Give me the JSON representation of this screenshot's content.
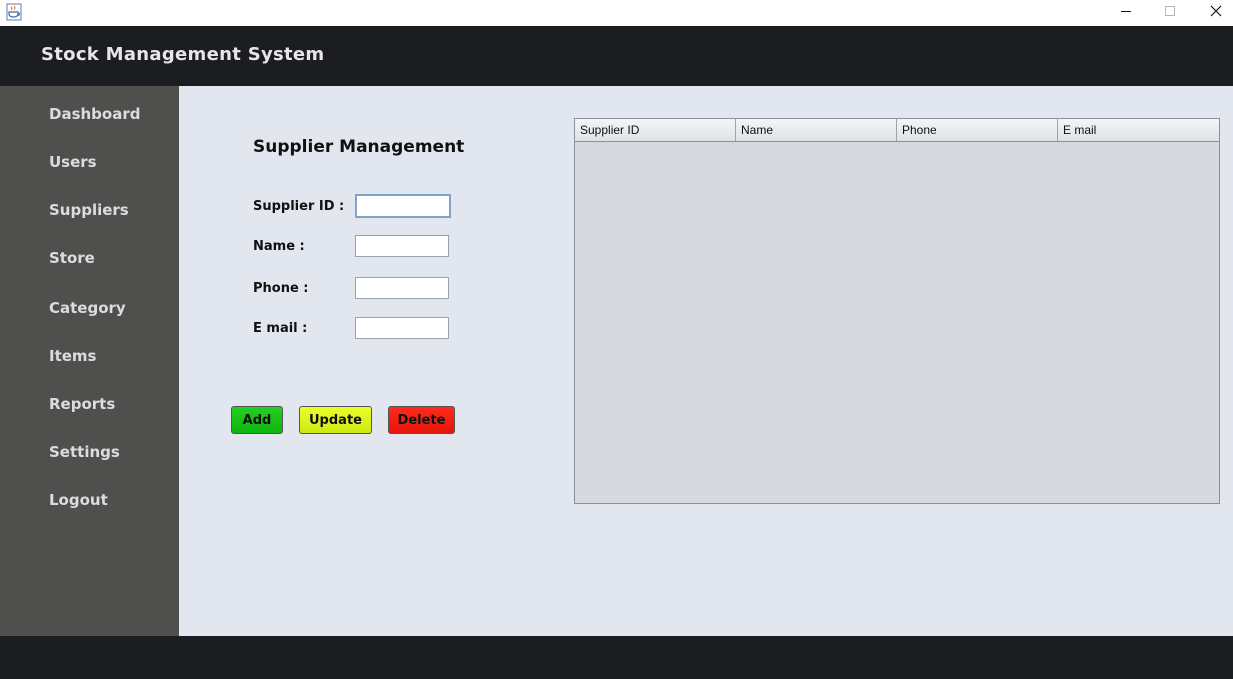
{
  "window": {
    "title_icon": "java-cup-icon",
    "controls": [
      "minimize-icon",
      "maximize-icon",
      "close-icon"
    ]
  },
  "header": {
    "title": "Stock Management System"
  },
  "sidebar": {
    "items": [
      {
        "label": "Dashboard"
      },
      {
        "label": "Users"
      },
      {
        "label": "Suppliers"
      },
      {
        "label": "Store"
      },
      {
        "label": "Category"
      },
      {
        "label": "Items"
      },
      {
        "label": "Reports"
      },
      {
        "label": "Settings"
      },
      {
        "label": "Logout"
      }
    ]
  },
  "form": {
    "title": "Supplier Management",
    "fields": [
      {
        "label": "Supplier ID :",
        "value": ""
      },
      {
        "label": "Name :",
        "value": ""
      },
      {
        "label": "Phone :",
        "value": ""
      },
      {
        "label": "E mail :",
        "value": ""
      }
    ],
    "buttons": {
      "add": "Add",
      "update": "Update",
      "delete": "Delete"
    }
  },
  "table": {
    "columns": [
      "Supplier ID",
      "Name",
      "Phone",
      "E mail"
    ],
    "rows": []
  },
  "colors": {
    "header_bg": "#1c1d21",
    "sidebar_bg": "#4f4f4d",
    "main_bg": "#e2e6ef",
    "add_button": "#13c013",
    "update_button": "#d9f218",
    "delete_button": "#f01b10"
  }
}
